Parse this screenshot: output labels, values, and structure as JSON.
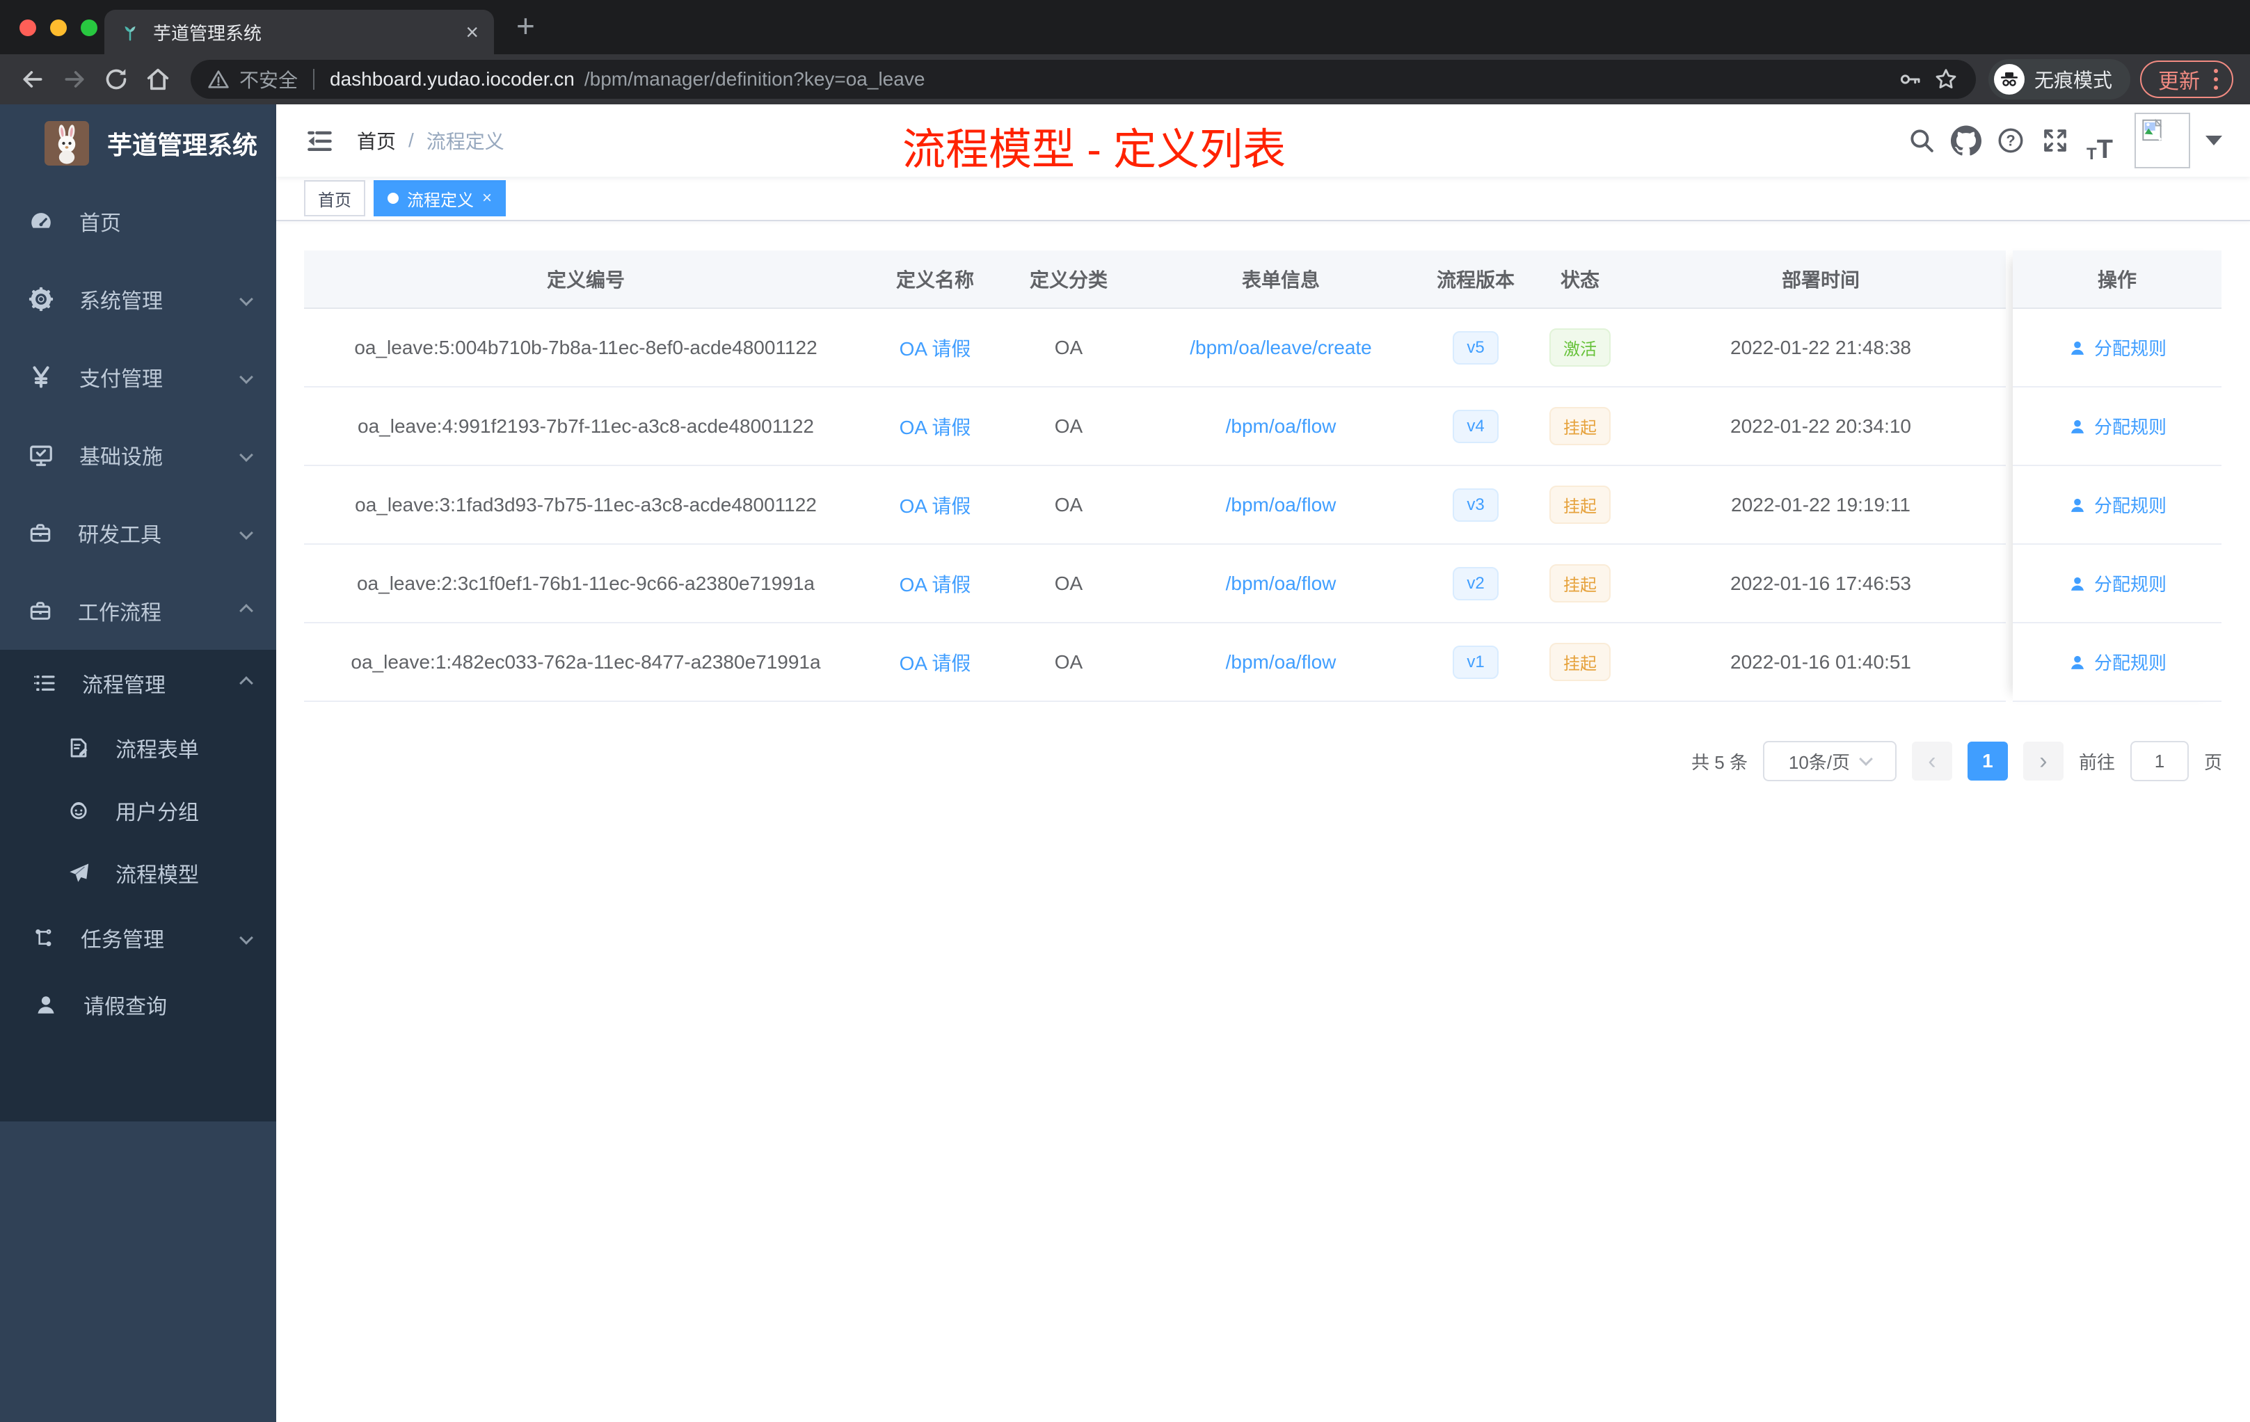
{
  "browser": {
    "tab_title": "芋道管理系统",
    "tab_close": "×",
    "new_tab": "+",
    "security_label": "不安全",
    "url_host": "dashboard.yudao.iocoder.cn",
    "url_path": "/bpm/manager/definition?key=oa_leave",
    "incognito_label": "无痕模式",
    "update_label": "更新",
    "traffic_colors": [
      "#ff5f57",
      "#febc2e",
      "#28c840"
    ]
  },
  "header": {
    "breadcrumb_home": "首页",
    "breadcrumb_sep": "/",
    "breadcrumb_current": "流程定义",
    "annotation": "流程模型 - 定义列表",
    "icons": [
      "search-icon",
      "github-icon",
      "help-icon",
      "fullscreen-icon",
      "font-size-icon"
    ]
  },
  "sidebar": {
    "logo_title": "芋道管理系统",
    "items": [
      {
        "key": "home",
        "label": "首页",
        "icon": "dashboard-icon",
        "depth": 1,
        "chevron": ""
      },
      {
        "key": "system",
        "label": "系统管理",
        "icon": "gear-icon",
        "depth": 1,
        "chevron": "down"
      },
      {
        "key": "payment",
        "label": "支付管理",
        "icon": "yen-icon",
        "depth": 1,
        "chevron": "down"
      },
      {
        "key": "infra",
        "label": "基础设施",
        "icon": "monitor-icon",
        "depth": 1,
        "chevron": "down"
      },
      {
        "key": "dev-tools",
        "label": "研发工具",
        "icon": "toolbox-icon",
        "depth": 1,
        "chevron": "down"
      },
      {
        "key": "workflow",
        "label": "工作流程",
        "icon": "briefcase-icon",
        "depth": 1,
        "chevron": "up"
      },
      {
        "key": "process-manage",
        "label": "流程管理",
        "icon": "tree-list-icon",
        "depth": 2,
        "chevron": "up"
      },
      {
        "key": "process-form",
        "label": "流程表单",
        "icon": "form-edit-icon",
        "depth": 3,
        "chevron": ""
      },
      {
        "key": "user-group",
        "label": "用户分组",
        "icon": "robot-icon",
        "depth": 3,
        "chevron": ""
      },
      {
        "key": "process-model",
        "label": "流程模型",
        "icon": "paper-plane-icon",
        "depth": 3,
        "chevron": ""
      },
      {
        "key": "task-manage",
        "label": "任务管理",
        "icon": "flow-branch-icon",
        "depth": 2,
        "chevron": "down"
      },
      {
        "key": "leave-query",
        "label": "请假查询",
        "icon": "user-icon",
        "depth": 2,
        "chevron": ""
      }
    ]
  },
  "tags": {
    "items": [
      {
        "label": "首页",
        "active": false
      },
      {
        "label": "流程定义",
        "active": true
      }
    ]
  },
  "table": {
    "columns": [
      {
        "label": "定义编号"
      },
      {
        "label": "定义名称"
      },
      {
        "label": "定义分类"
      },
      {
        "label": "表单信息"
      },
      {
        "label": "流程版本"
      },
      {
        "label": "状态"
      },
      {
        "label": "部署时间"
      }
    ],
    "fixed_column": "操作",
    "action_label": "分配规则",
    "rows": [
      {
        "id": "oa_leave:5:004b710b-7b8a-11ec-8ef0-acde48001122",
        "name": "OA 请假",
        "category": "OA",
        "form": "/bpm/oa/leave/create",
        "version": "v5",
        "status": {
          "label": "激活",
          "type": "success"
        },
        "deployed": "2022-01-22 21:48:38"
      },
      {
        "id": "oa_leave:4:991f2193-7b7f-11ec-a3c8-acde48001122",
        "name": "OA 请假",
        "category": "OA",
        "form": "/bpm/oa/flow",
        "version": "v4",
        "status": {
          "label": "挂起",
          "type": "warning"
        },
        "deployed": "2022-01-22 20:34:10"
      },
      {
        "id": "oa_leave:3:1fad3d93-7b75-11ec-a3c8-acde48001122",
        "name": "OA 请假",
        "category": "OA",
        "form": "/bpm/oa/flow",
        "version": "v3",
        "status": {
          "label": "挂起",
          "type": "warning"
        },
        "deployed": "2022-01-22 19:19:11"
      },
      {
        "id": "oa_leave:2:3c1f0ef1-76b1-11ec-9c66-a2380e71991a",
        "name": "OA 请假",
        "category": "OA",
        "form": "/bpm/oa/flow",
        "version": "v2",
        "status": {
          "label": "挂起",
          "type": "warning"
        },
        "deployed": "2022-01-16 17:46:53"
      },
      {
        "id": "oa_leave:1:482ec033-762a-11ec-8477-a2380e71991a",
        "name": "OA 请假",
        "category": "OA",
        "form": "/bpm/oa/flow",
        "version": "v1",
        "status": {
          "label": "挂起",
          "type": "warning"
        },
        "deployed": "2022-01-16 01:40:51"
      }
    ]
  },
  "pagination": {
    "total": "共 5 条",
    "page_size": "10条/页",
    "prev": "‹",
    "next": "›",
    "current": "1",
    "goto_label": "前往",
    "goto_value": "1",
    "page_unit": "页"
  },
  "colors": {
    "accent": "#409eff",
    "success": "#67c23a",
    "warning": "#e6a23c",
    "annotation_red": "#ff2200",
    "sidebar_bg": "#304156",
    "submenu_bg": "#1f2d3d",
    "update_pill": "#f28b82"
  }
}
